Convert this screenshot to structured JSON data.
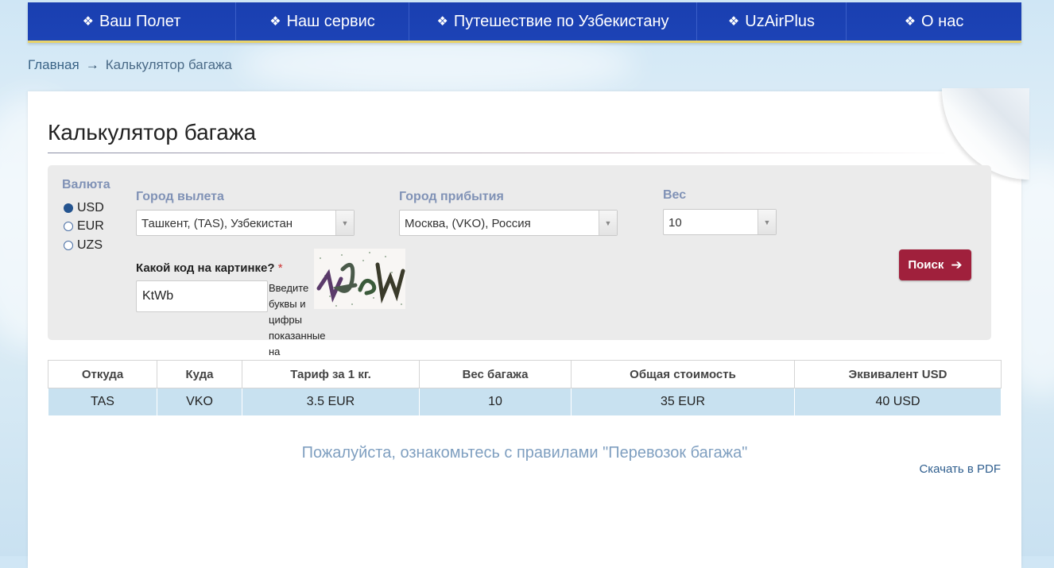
{
  "nav": {
    "items": [
      {
        "label": "Ваш Полет"
      },
      {
        "label": "Наш сервис"
      },
      {
        "label": "Путешествие по Узбекистану"
      },
      {
        "label": "UzAirPlus"
      },
      {
        "label": "О нас"
      }
    ]
  },
  "breadcrumb": {
    "home": "Главная",
    "separator": "→",
    "current": "Калькулятор багажа"
  },
  "page_title": "Калькулятор багажа",
  "form": {
    "currency_label": "Валюта",
    "currencies": [
      "USD",
      "EUR",
      "UZS"
    ],
    "selected_currency": "USD",
    "from_label": "Город вылета",
    "from_value": "Ташкент, (TAS), Узбекистан",
    "to_label": "Город прибытия",
    "to_value": "Москва, (VKO), Россия",
    "weight_label": "Вес",
    "weight_value": "10",
    "captcha_label": "Какой код на картинке?",
    "captcha_required": "*",
    "captcha_value": "KtWb",
    "captcha_hint": "Введите буквы и цифры показанные на изображении",
    "search_label": "Поиск"
  },
  "table": {
    "headers": [
      "Откуда",
      "Куда",
      "Тариф за 1 кг.",
      "Вес багажа",
      "Общая стоимость",
      "Эквивалент USD"
    ],
    "rows": [
      [
        "TAS",
        "VKO",
        "3.5 EUR",
        "10",
        "35 EUR",
        "40 USD"
      ]
    ]
  },
  "note": "Пожалуйста, ознакомьтесь с правилами \"Перевозок багажа\"",
  "download_pdf": "Скачать в PDF",
  "colors": {
    "nav": "#1c43b6",
    "accent_button": "#a0203c",
    "label": "#8092b6",
    "row_bg": "#c8e1f0"
  }
}
